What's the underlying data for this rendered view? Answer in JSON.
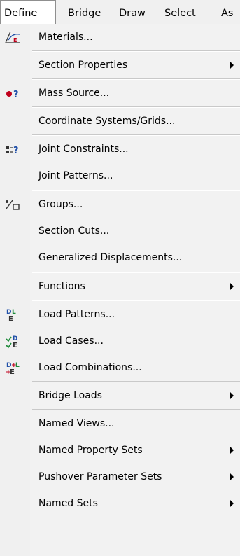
{
  "menubar": {
    "items": [
      "Define",
      "Bridge",
      "Draw",
      "Select",
      "As"
    ]
  },
  "menu": {
    "items": [
      {
        "label": "Materials...",
        "icon": "materials-icon",
        "submenu": false
      },
      {
        "label": "Section Properties",
        "icon": null,
        "submenu": true
      },
      {
        "label": "Mass  Source...",
        "icon": "mass-source-icon",
        "submenu": false
      },
      {
        "label": "Coordinate Systems/Grids...",
        "icon": null,
        "submenu": false
      },
      {
        "label": "Joint Constraints...",
        "icon": "joint-constraints-icon",
        "submenu": false
      },
      {
        "label": "Joint Patterns...",
        "icon": null,
        "submenu": false
      },
      {
        "label": "Groups...",
        "icon": "groups-icon",
        "submenu": false
      },
      {
        "label": "Section Cuts...",
        "icon": null,
        "submenu": false
      },
      {
        "label": "Generalized Displacements...",
        "icon": null,
        "submenu": false
      },
      {
        "label": "Functions",
        "icon": null,
        "submenu": true
      },
      {
        "label": "Load Patterns...",
        "icon": "load-patterns-icon",
        "submenu": false
      },
      {
        "label": "Load Cases...",
        "icon": "load-cases-icon",
        "submenu": false
      },
      {
        "label": "Load Combinations...",
        "icon": "load-combinations-icon",
        "submenu": false
      },
      {
        "label": "Bridge Loads",
        "icon": null,
        "submenu": true
      },
      {
        "label": "Named Views...",
        "icon": null,
        "submenu": false
      },
      {
        "label": "Named Property Sets",
        "icon": null,
        "submenu": true
      },
      {
        "label": "Pushover Parameter Sets",
        "icon": null,
        "submenu": true
      },
      {
        "label": "Named Sets",
        "icon": null,
        "submenu": true
      }
    ]
  },
  "colors": {
    "menu_bg": "#f2f2f2",
    "separator": "#c9c9c9",
    "icon_red": "#c0001c",
    "icon_blue": "#1f4fa8",
    "icon_green": "#1e8a3a"
  }
}
